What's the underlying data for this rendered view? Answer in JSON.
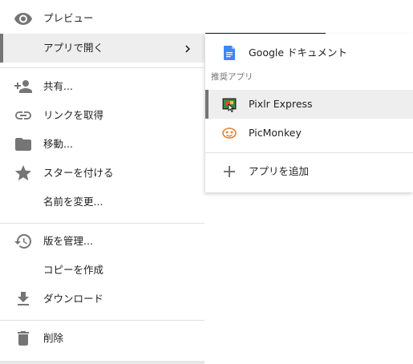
{
  "menu": {
    "preview": "プレビュー",
    "open_with": "アプリで開く",
    "share": "共有...",
    "get_link": "リンクを取得",
    "move": "移動...",
    "star": "スターを付ける",
    "rename": "名前を変更...",
    "manage_versions": "版を管理...",
    "make_copy": "コピーを作成",
    "download": "ダウンロード",
    "delete": "削除"
  },
  "submenu": {
    "google_docs": "Google ドキュメント",
    "suggested_header": "推奨アプリ",
    "pixlr": "Pixlr Express",
    "picmonkey": "PicMonkey",
    "add_app": "アプリを追加"
  },
  "icons": {
    "preview": "eye-icon",
    "open_with_arrow": "chevron-right-icon",
    "share": "person-add-icon",
    "get_link": "link-icon",
    "move": "folder-icon",
    "star": "star-icon",
    "manage_versions": "history-icon",
    "download": "download-icon",
    "delete": "trash-icon",
    "google_docs": "google-docs-icon",
    "pixlr": "pixlr-icon",
    "picmonkey": "picmonkey-icon",
    "add_app": "plus-icon"
  },
  "colors": {
    "icon_grey": "#757575",
    "docs_blue": "#4285f4",
    "picmonkey_orange": "#e8812f",
    "pixlr_green": "#3b8a3c",
    "active_bg": "#eeeeee"
  }
}
